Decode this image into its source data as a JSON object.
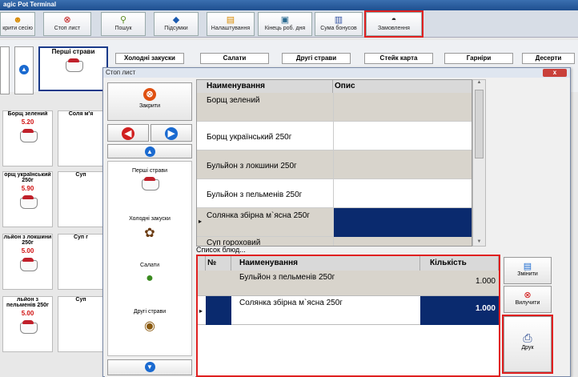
{
  "app": {
    "title": "agic Pot Terminal"
  },
  "toolbar": [
    {
      "label": "крити сесію",
      "icon": "person-icon"
    },
    {
      "label": "Стоп лист",
      "icon": "stop-icon"
    },
    {
      "label": "Пошук",
      "icon": "search-icon"
    },
    {
      "label": "Підсумки",
      "icon": "diamond-icon"
    },
    {
      "label": "Налаштування",
      "icon": "document-icon"
    },
    {
      "label": "Кінець роб. дня",
      "icon": "floppy-icon"
    },
    {
      "label": "Сума бонусов",
      "icon": "bonus-icon"
    },
    {
      "label": "Замовлення",
      "icon": "pot-icon"
    }
  ],
  "categories": [
    "Перші страви",
    "Холодні закуски",
    "Салати",
    "Другі страви",
    "Стейк карта",
    "Гарніри",
    "Десерти"
  ],
  "tiles": [
    {
      "name": "Борщ зелений",
      "price": "5.20"
    },
    {
      "name": "орщ український 250г",
      "price": "5.90"
    },
    {
      "name": "льйон з локшини 250г",
      "price": "5.00"
    },
    {
      "name": "льйон з пельменів 250г",
      "price": "5.00"
    }
  ],
  "tiles2": [
    "Соля м'я",
    "Суп",
    "Суп г",
    "Суп"
  ],
  "dialog": {
    "title": "Стоп лист",
    "close_button": "Закрити",
    "close_x": "x",
    "list_caption": "Список блюд...",
    "left_categories": [
      "Перші страви",
      "Холодні закуски",
      "Салати",
      "Другі страви"
    ],
    "grid1": {
      "headers": [
        "Наименування",
        "Опис"
      ],
      "rows": [
        "Борщ зелений",
        "Борщ український 250г",
        "Бульйон з локшини 250г",
        "Бульйон з пельменів 250г",
        "Солянка збірна м`ясна 250г",
        "Суп гороховий"
      ]
    },
    "grid2": {
      "headers": [
        "№",
        "Наименування",
        "Кількість"
      ],
      "rows": [
        {
          "name": "Бульйон з пельменів 250г",
          "qty": "1.000"
        },
        {
          "name": "Солянка збірна м`ясна 250г",
          "qty": "1.000"
        }
      ]
    },
    "right_buttons": [
      "Змінити",
      "Вилучити",
      "Друк"
    ]
  },
  "colors": {
    "accent": "#0a2a6e",
    "price": "#d01010",
    "highlight": "#e02020"
  }
}
